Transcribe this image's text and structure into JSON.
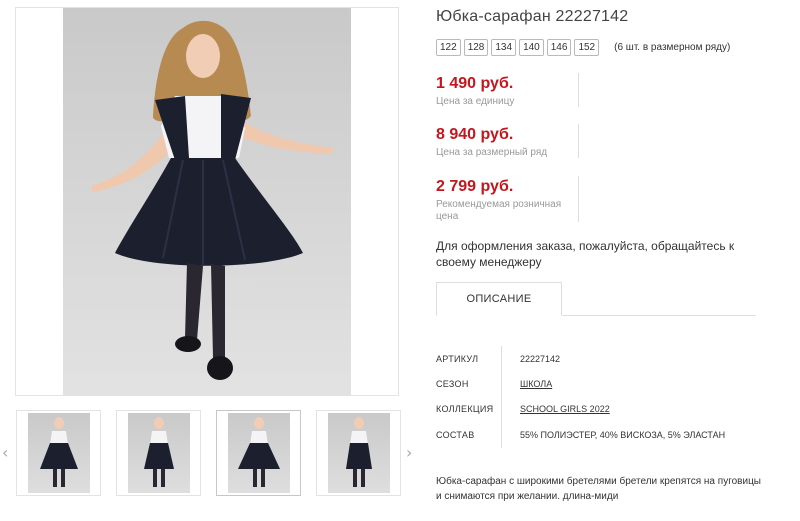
{
  "product": {
    "title": "Юбка-сарафан 22227142",
    "sizes": [
      "122",
      "128",
      "134",
      "140",
      "146",
      "152"
    ],
    "sizes_note": "(6 шт. в размерном ряду)"
  },
  "prices": [
    {
      "value": "1 490 руб.",
      "label": "Цена за единицу"
    },
    {
      "value": "8 940 руб.",
      "label": "Цена за размерный ряд"
    },
    {
      "value": "2 799 руб.",
      "label": "Рекомендуемая розничная цена"
    }
  ],
  "order_note": "Для оформления заказа, пожалуйста, обращайтесь к своему менеджеру",
  "tabs": {
    "description": "ОПИСАНИЕ"
  },
  "specs": [
    {
      "key": "АРТИКУЛ",
      "value": "22227142"
    },
    {
      "key": "СЕЗОН",
      "value": "ШКОЛА"
    },
    {
      "key": "КОЛЛЕКЦИЯ",
      "value": "SCHOOL GIRLS 2022"
    },
    {
      "key": "СОСТАВ",
      "value": "55% ПОЛИЭСТЕР, 40% ВИСКОЗА, 5% ЭЛАСТАН"
    }
  ],
  "description": "Юбка-сарафан с широкими бретелями бретели крепятся на пуговицы и снимаются при желании. длина-миди",
  "icons": {
    "prev": "chevron-left-icon",
    "next": "chevron-right-icon"
  },
  "colors": {
    "price": "#c4161c",
    "dress": "#1c1f2e"
  }
}
